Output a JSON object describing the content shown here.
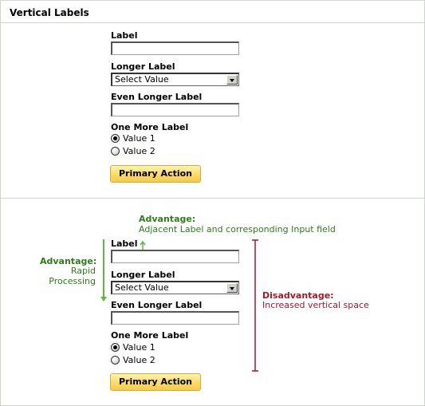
{
  "header": {
    "title": "Vertical Labels"
  },
  "form1": {
    "label_field": {
      "label": "Label",
      "value": ""
    },
    "longer_field": {
      "label": "Longer Label",
      "value": "Select Value"
    },
    "even_longer_field": {
      "label": "Even Longer Label",
      "value": ""
    },
    "one_more": {
      "label": "One More Label",
      "options": [
        "Value 1",
        "Value 2"
      ],
      "selected": "Value 1"
    },
    "primary_action": "Primary Action"
  },
  "form2": {
    "label_field": {
      "label": "Label",
      "value": ""
    },
    "longer_field": {
      "label": "Longer Label",
      "value": "Select Value"
    },
    "even_longer_field": {
      "label": "Even Longer Label",
      "value": ""
    },
    "one_more": {
      "label": "One More Label",
      "options": [
        "Value 1",
        "Value 2"
      ],
      "selected": "Value 1"
    },
    "primary_action": "Primary Action"
  },
  "annotations": {
    "advantage_adjacent": {
      "title": "Advantage:",
      "text": "Adjacent Label and corresponding Input field"
    },
    "advantage_rapid": {
      "title": "Advantage:",
      "text": "Rapid Processing"
    },
    "disadvantage": {
      "title": "Disadvantage:",
      "text": "Increased vertical space"
    }
  },
  "colors": {
    "advantage": "#2e7d1a",
    "disadvantage": "#9b1b2a",
    "button": "#fbd866",
    "arrow": "#5cb840"
  }
}
